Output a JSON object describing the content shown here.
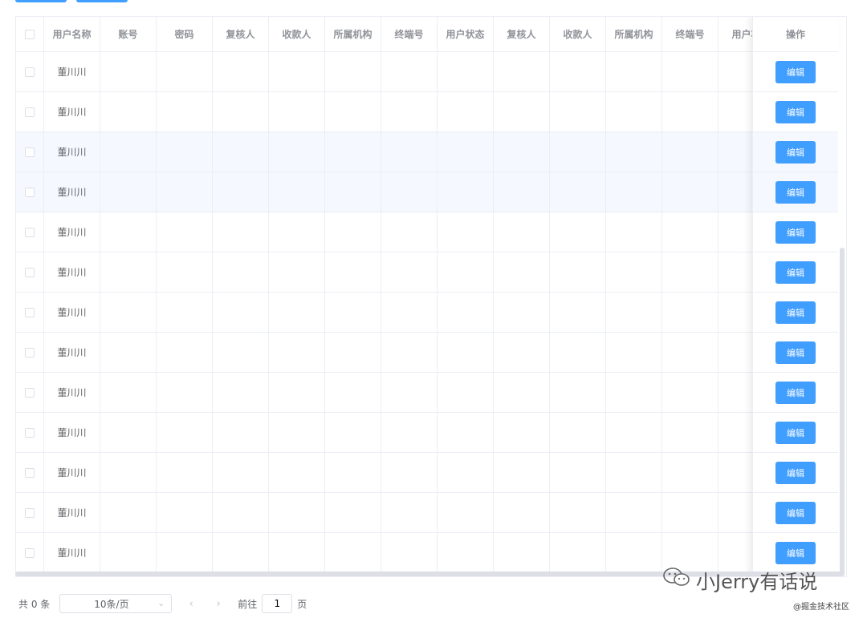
{
  "table": {
    "headers": [
      "用户名称",
      "账号",
      "密码",
      "复核人",
      "收款人",
      "所属机构",
      "终端号",
      "用户状态",
      "复核人",
      "收款人",
      "所属机构",
      "终端号",
      "用户状"
    ],
    "action_header": "操作",
    "rows": [
      {
        "name": "董川川",
        "action": "编辑"
      },
      {
        "name": "董川川",
        "action": "编辑"
      },
      {
        "name": "董川川",
        "action": "编辑"
      },
      {
        "name": "董川川",
        "action": "编辑"
      },
      {
        "name": "董川川",
        "action": "编辑"
      },
      {
        "name": "董川川",
        "action": "编辑"
      },
      {
        "name": "董川川",
        "action": "编辑"
      },
      {
        "name": "董川川",
        "action": "编辑"
      },
      {
        "name": "董川川",
        "action": "编辑"
      },
      {
        "name": "董川川",
        "action": "编辑"
      },
      {
        "name": "董川川",
        "action": "编辑"
      },
      {
        "name": "董川川",
        "action": "编辑"
      },
      {
        "name": "董川川",
        "action": "编辑"
      }
    ]
  },
  "pagination": {
    "total_label": "共 0 条",
    "page_size": "10条/页",
    "prev_icon": "chevron-left-icon",
    "next_icon": "chevron-right-icon",
    "goto_label": "前往",
    "goto_value": "1",
    "page_suffix": "页"
  },
  "watermark": {
    "text": "小Jerry有话说",
    "icon": "wechat-icon",
    "site": "@掘金技术社区"
  },
  "colors": {
    "primary": "#409eff",
    "border": "#ebeef5",
    "header_text": "#909399",
    "body_text": "#606266",
    "hover_row": "#f5f9ff"
  }
}
